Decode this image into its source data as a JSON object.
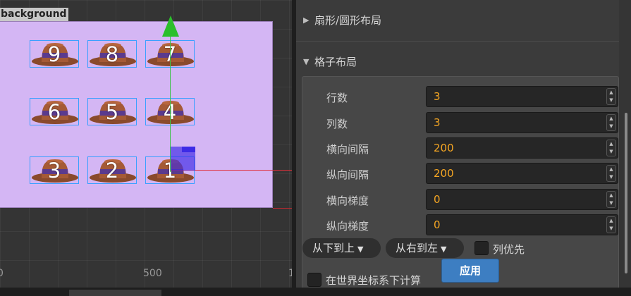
{
  "scene": {
    "node_label": "background",
    "ruler_labels": [
      "0",
      "500",
      "1"
    ],
    "hats": [
      {
        "number": "9"
      },
      {
        "number": "8"
      },
      {
        "number": "7"
      },
      {
        "number": "6"
      },
      {
        "number": "5"
      },
      {
        "number": "4"
      },
      {
        "number": "3"
      },
      {
        "number": "2"
      },
      {
        "number": "1"
      }
    ]
  },
  "inspector": {
    "collapsed_section": {
      "title": "扇形/圆形布局",
      "expanded": false
    },
    "grid_section": {
      "title": "格子布局",
      "expanded": true,
      "fields": [
        {
          "label": "行数",
          "value": "3"
        },
        {
          "label": "列数",
          "value": "3"
        },
        {
          "label": "横向间隔",
          "value": "200"
        },
        {
          "label": "纵向间隔",
          "value": "200"
        },
        {
          "label": "横向梯度",
          "value": "0"
        },
        {
          "label": "纵向梯度",
          "value": "0"
        }
      ],
      "vertical_order_dropdown": "从下到上",
      "horizontal_order_dropdown": "从右到左",
      "column_first_label": "列优先",
      "column_first_checked": false,
      "world_coords_label": "在世界坐标系下计算",
      "world_coords_checked": false,
      "apply_label": "应用"
    }
  },
  "colors": {
    "accent_button": "#3d7ec2",
    "value_text": "#f5a623",
    "background_node": "#d4b6f4",
    "y_axis": "#3ec24a",
    "x_axis": "#e0303a"
  }
}
